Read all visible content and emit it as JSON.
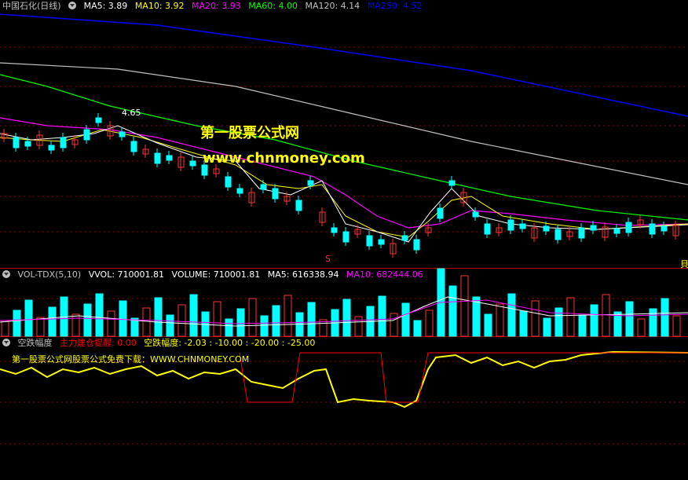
{
  "header": {
    "stock": "中国石化(日线)",
    "ma": [
      {
        "text": "MA5: 3.89",
        "color": "#ffffff"
      },
      {
        "text": "MA10: 3.92",
        "color": "#ffff00"
      },
      {
        "text": "MA20: 3.93",
        "color": "#ff00ff"
      },
      {
        "text": "MA60: 4.00",
        "color": "#00ff00"
      },
      {
        "text": "MA120: 4.14",
        "color": "#c0c0c0"
      },
      {
        "text": "MA250: 4.52",
        "color": "#0000ff"
      }
    ]
  },
  "price_panel": {
    "high_label": "4.65",
    "marker_s": "S",
    "right_marker": "貝",
    "watermark1": "第一股票公式网",
    "watermark2": "www.chnmoney.com"
  },
  "volume_panel": {
    "name": "VOL-TDX(5,10)",
    "items": [
      {
        "text": "VVOL: 710001.81",
        "color": "#ffffff"
      },
      {
        "text": "VOLUME: 710001.81",
        "color": "#ffffff"
      },
      {
        "text": "MA5: 616338.94",
        "color": "#ffffff"
      },
      {
        "text": "MA10: 682444.06",
        "color": "#ff00ff"
      }
    ]
  },
  "indicator_panel": {
    "name": "空跌幅度",
    "items": [
      {
        "text": "主力建仓提醒: 0.00",
        "color": "#ff0000"
      },
      {
        "text": "空跌幅度: -2.03 : -10.00 : -20.00 : -25.00",
        "color": "#ffff00"
      }
    ],
    "watermark": "第一股票公式网股票公式免费下载：WWW.CHNMONEY.COM"
  },
  "colors": {
    "up": "#ff3333",
    "down": "#00ffff",
    "ma5": "#ffffff",
    "ma10": "#ffff00",
    "ma20": "#ff00ff",
    "ma60": "#00ff00",
    "ma120": "#c0c0c0",
    "ma250": "#0000ff"
  }
}
